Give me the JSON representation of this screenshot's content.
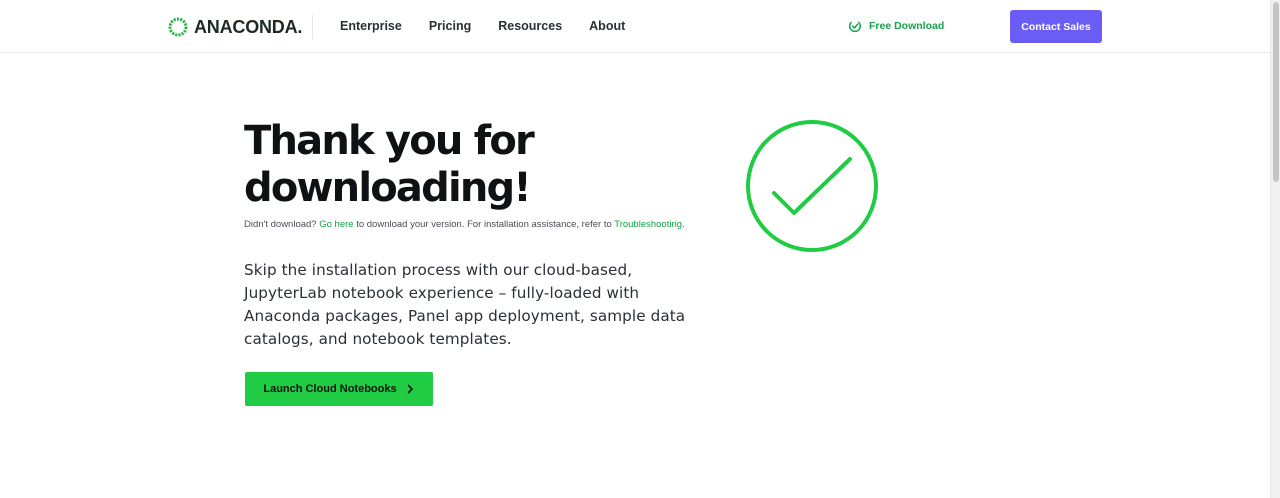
{
  "header": {
    "logo_text": "ANACONDA",
    "logo_suffix": ".",
    "nav": [
      "Enterprise",
      "Pricing",
      "Resources",
      "About"
    ],
    "free_download_label": "Free Download",
    "contact_label": "Contact Sales"
  },
  "main": {
    "headline_line1": "Thank you for",
    "headline_line2": "downloading!",
    "note": {
      "prefix": "Didn't download? ",
      "go_here": "Go here",
      "middle": " to download your version. For installation assistance, refer to ",
      "troubleshooting": "Troubleshooting",
      "suffix": "."
    },
    "body": "Skip the installation process with our cloud-based, JupyterLab notebook experience – fully-loaded with Anaconda packages, Panel app deployment, sample data catalogs, and notebook templates.",
    "launch_label": "Launch Cloud Notebooks"
  },
  "colors": {
    "accent_green": "#1fcc43",
    "link_green": "#16a34a",
    "contact_purple": "#6b5cf5"
  },
  "icons": {
    "logo": "anaconda-ring-icon",
    "free_download": "download-circle-icon",
    "launch": "chevron-right-icon",
    "hero": "checkmark-circle-icon"
  }
}
